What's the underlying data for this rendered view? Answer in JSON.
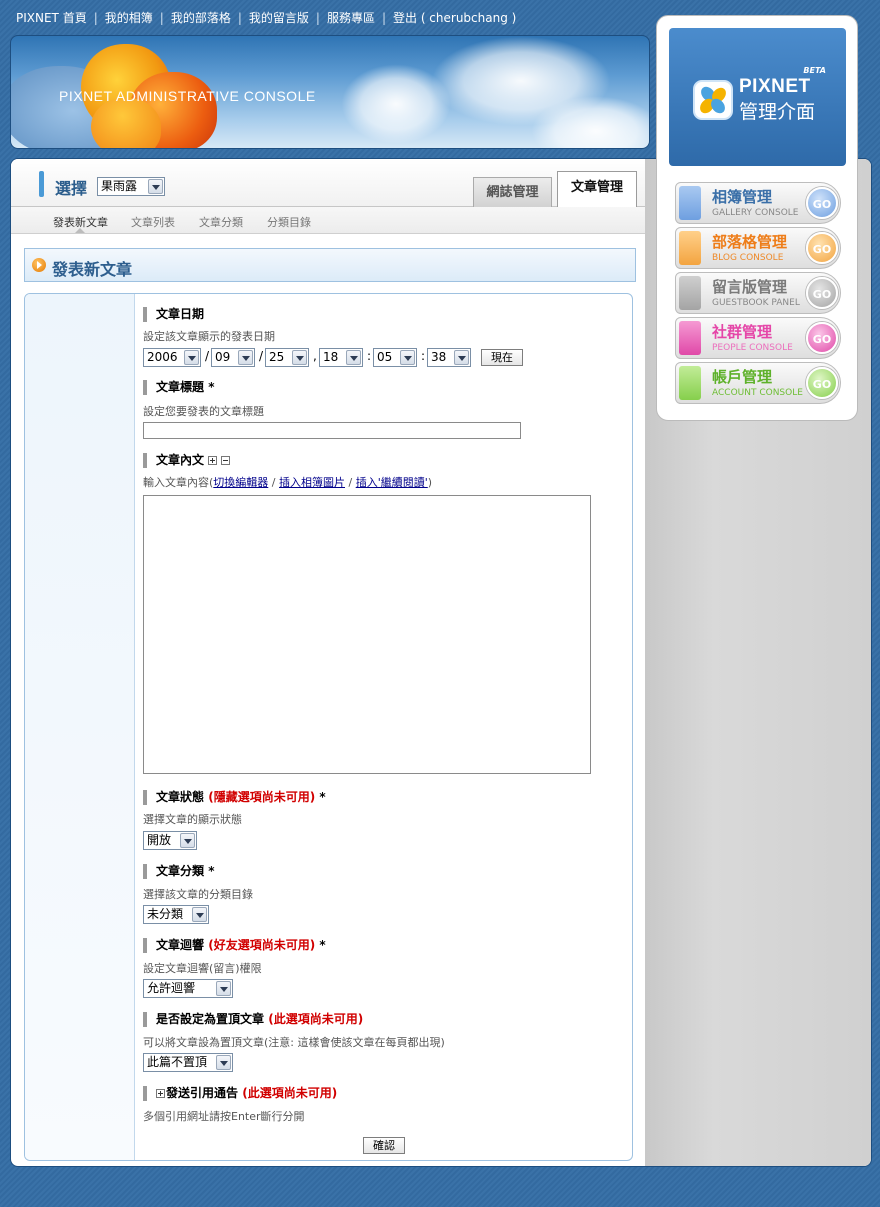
{
  "topnav": {
    "items": [
      "PIXNET 首頁",
      "我的相簿",
      "我的部落格",
      "我的留言版",
      "服務專區",
      "登出 ( cherubchang )"
    ]
  },
  "banner": {
    "title": "PIXNET ADMINISTRATIVE CONSOLE"
  },
  "logo": {
    "beta": "BETA",
    "brand": "PIXNET",
    "subtitle": "管理介面"
  },
  "consoles": [
    {
      "cn": "相簿管理",
      "en": "GALLERY CONSOLE",
      "go": "GO",
      "color": "#4a89d6"
    },
    {
      "cn": "部落格管理",
      "en": "BLOG CONSOLE",
      "go": "GO",
      "color": "#f08a1a"
    },
    {
      "cn": "留言版管理",
      "en": "GUESTBOOK PANEL",
      "go": "GO",
      "color": "#8a8a8a"
    },
    {
      "cn": "社群管理",
      "en": "PEOPLE CONSOLE",
      "go": "GO",
      "color": "#e546a8"
    },
    {
      "cn": "帳戶管理",
      "en": "ACCOUNT CONSOLE",
      "go": "GO",
      "color": "#74c63a"
    }
  ],
  "toolbar": {
    "select_label": "選擇",
    "blog_select": "果雨露",
    "tabs": [
      "網誌管理",
      "文章管理"
    ]
  },
  "subnav": [
    "發表新文章",
    "文章列表",
    "文章分類",
    "分類目錄"
  ],
  "page": {
    "title": "發表新文章"
  },
  "form": {
    "date": {
      "title": "文章日期",
      "desc": "設定該文章顯示的發表日期",
      "year": "2006",
      "month": "09",
      "day": "25",
      "hour": "18",
      "minute": "05",
      "second": "38",
      "sep_date": "/",
      "sep_comma": ",",
      "sep_time": ":",
      "now_button": "現在"
    },
    "subject": {
      "title": "文章標題",
      "required": "*",
      "desc": "設定您要發表的文章標題",
      "value": ""
    },
    "body": {
      "title": "文章內文",
      "desc_prefix": "輸入文章內容(",
      "link_switch": "切換編輯器",
      "link_photo": "插入相簿圖片",
      "link_more": "插入'繼續閱讀'",
      "desc_sep": " / ",
      "desc_suffix": ")"
    },
    "status": {
      "title": "文章狀態",
      "note": "(隱藏選項尚未可用)",
      "required": "*",
      "desc": "選擇文章的顯示狀態",
      "value": "開放"
    },
    "category": {
      "title": "文章分類",
      "required": "*",
      "desc": "選擇該文章的分類目錄",
      "value": "未分類"
    },
    "response": {
      "title": "文章迴響",
      "note": "(好友選項尚未可用)",
      "required": "*",
      "desc": "設定文章迴響(留言)權限",
      "value": "允許迴響"
    },
    "sticky": {
      "title": "是否設定為置頂文章",
      "note": "(此選項尚未可用)",
      "desc": "可以將文章設為置頂文章(注意: 這樣會使該文章在每頁都出現)",
      "value": "此篇不置頂"
    },
    "trackback": {
      "title": "發送引用通告",
      "note": "(此選項尚未可用)",
      "desc": "多個引用網址請按Enter斷行分開"
    },
    "submit": "確認"
  }
}
